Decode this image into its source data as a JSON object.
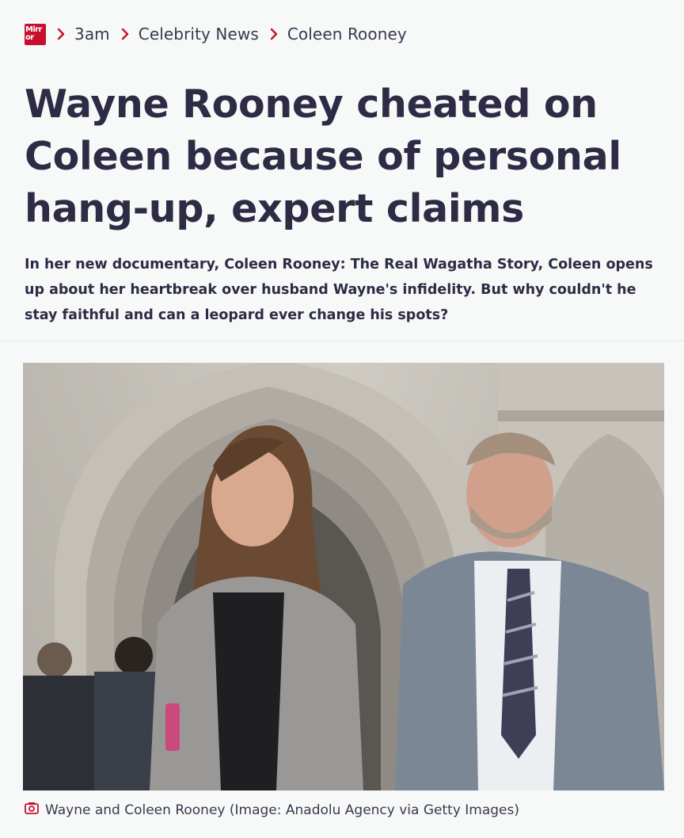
{
  "breadcrumb": {
    "logo_text_line1": "Mirr",
    "logo_text_line2": "or",
    "items": [
      "3am",
      "Celebrity News",
      "Coleen Rooney"
    ]
  },
  "headline": "Wayne Rooney cheated on Coleen because of personal hang-up, expert claims",
  "standfirst": "In her new documentary, Coleen Rooney: The Real Wagatha Story, Coleen opens up about her heartbreak over husband Wayne's infidelity. But why couldn't he stay faithful and can a leopard ever change his spots?",
  "image": {
    "caption": "Wayne and Coleen Rooney (Image: Anadolu Agency via Getty Images)"
  },
  "colors": {
    "brand_red": "#c8102e",
    "headline_text": "#2e2b45",
    "background": "#f7f8f8"
  },
  "icons": [
    "mirror-logo",
    "chevron-right-icon",
    "camera-icon"
  ]
}
